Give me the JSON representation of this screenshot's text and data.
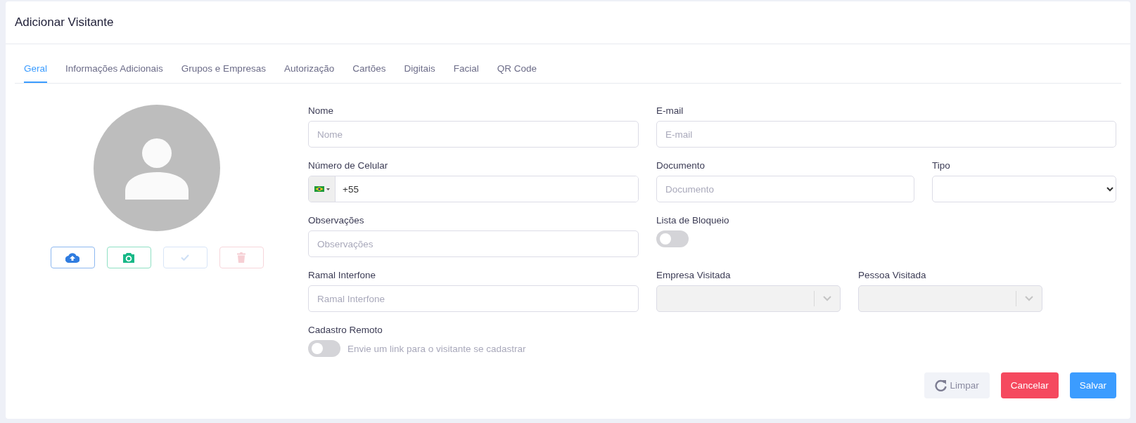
{
  "title": "Adicionar Visitante",
  "tabs": [
    {
      "label": "Geral",
      "selected": true
    },
    {
      "label": "Informações Adicionais",
      "selected": false
    },
    {
      "label": "Grupos e Empresas",
      "selected": false
    },
    {
      "label": "Autorização",
      "selected": false
    },
    {
      "label": "Cartões",
      "selected": false
    },
    {
      "label": "Digitais",
      "selected": false
    },
    {
      "label": "Facial",
      "selected": false
    },
    {
      "label": "QR Code",
      "selected": false
    }
  ],
  "photo_buttons": [
    {
      "kind": "upload",
      "disabled": false
    },
    {
      "kind": "camera",
      "disabled": false
    },
    {
      "kind": "confirm",
      "disabled": true
    },
    {
      "kind": "delete",
      "disabled": true
    }
  ],
  "rows": [
    {
      "fields": [
        {
          "kind": "text",
          "label": "Nome",
          "placeholder": "Nome"
        },
        {
          "kind": "text",
          "label": "E-mail",
          "placeholder": "E-mail"
        }
      ]
    },
    {
      "fields": [
        {
          "kind": "phone",
          "label": "Número de Celular",
          "value": "+55"
        },
        {
          "kind": "text",
          "label": "Documento",
          "placeholder": "Documento"
        },
        {
          "kind": "select",
          "label": "Tipo"
        }
      ]
    },
    {
      "fields": [
        {
          "kind": "text",
          "label": "Observações",
          "placeholder": "Observações"
        },
        {
          "kind": "toggle",
          "label": "Lista de Bloqueio",
          "on": false
        }
      ]
    },
    {
      "fields": [
        {
          "kind": "text",
          "label": "Ramal Interfone",
          "placeholder": "Ramal Interfone"
        },
        {
          "kind": "combo",
          "label": "Empresa Visitada",
          "disabled": true
        },
        {
          "kind": "combo",
          "label": "Pessoa Visitada",
          "disabled": true
        }
      ]
    },
    {
      "fields": [
        {
          "kind": "toggle",
          "label": "Cadastro Remoto",
          "on": false,
          "hint": "Envie um link para o visitante se cadastrar"
        }
      ]
    }
  ],
  "actions": [
    {
      "kind": "reset",
      "label": "Limpar"
    },
    {
      "kind": "cancel",
      "label": "Cancelar"
    },
    {
      "kind": "save",
      "label": "Salvar"
    }
  ]
}
